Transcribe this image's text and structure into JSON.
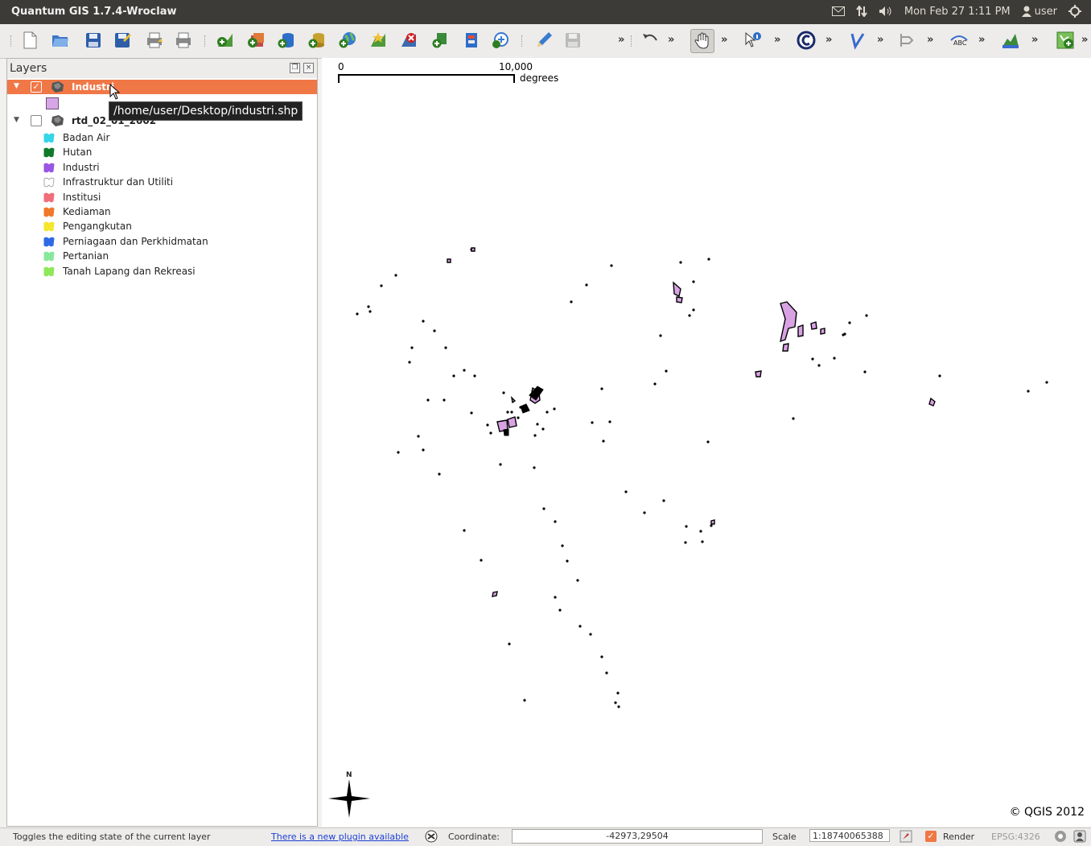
{
  "window": {
    "title": "Quantum GIS 1.7.4-Wroclaw",
    "datetime": "Mon Feb 27  1:11 PM",
    "user": "user"
  },
  "layers_panel": {
    "title": "Layers",
    "layers": [
      {
        "name": "Industri",
        "checked": true,
        "selected": true
      },
      {
        "name": "rtd_02_01_2002",
        "checked": false,
        "selected": false
      }
    ],
    "categories": [
      {
        "label": "Badan Air",
        "color": "#35d6e8"
      },
      {
        "label": "Hutan",
        "color": "#0f7a2a"
      },
      {
        "label": "Industri",
        "color": "#9a55e2"
      },
      {
        "label": "Infrastruktur dan Utiliti",
        "color": "#ffffff"
      },
      {
        "label": "Institusi",
        "color": "#ef6e7a"
      },
      {
        "label": "Kediaman",
        "color": "#f0782a"
      },
      {
        "label": "Pengangkutan",
        "color": "#f4e62a"
      },
      {
        "label": "Perniagaan dan Perkhidmatan",
        "color": "#2f69e6"
      },
      {
        "label": "Pertanian",
        "color": "#88e89a"
      },
      {
        "label": "Tanah Lapang dan Rekreasi",
        "color": "#8ee85a"
      }
    ],
    "tooltip": "/home/user/Desktop/industri.shp"
  },
  "map": {
    "scalebar": {
      "start": "0",
      "end": "10,000",
      "unit": "degrees"
    },
    "copyright": "© QGIS 2012",
    "north_label": "N",
    "fill_color": "#d9a2e3"
  },
  "status": {
    "message": "Toggles the editing state of the current layer",
    "plugin_link": "There is a new plugin available",
    "coordinate_label": "Coordinate:",
    "coordinate_value": "-42973,29504",
    "scale_label": "Scale",
    "scale_value": "1:18740065388",
    "render_label": "Render",
    "crs": "EPSG:4326"
  }
}
